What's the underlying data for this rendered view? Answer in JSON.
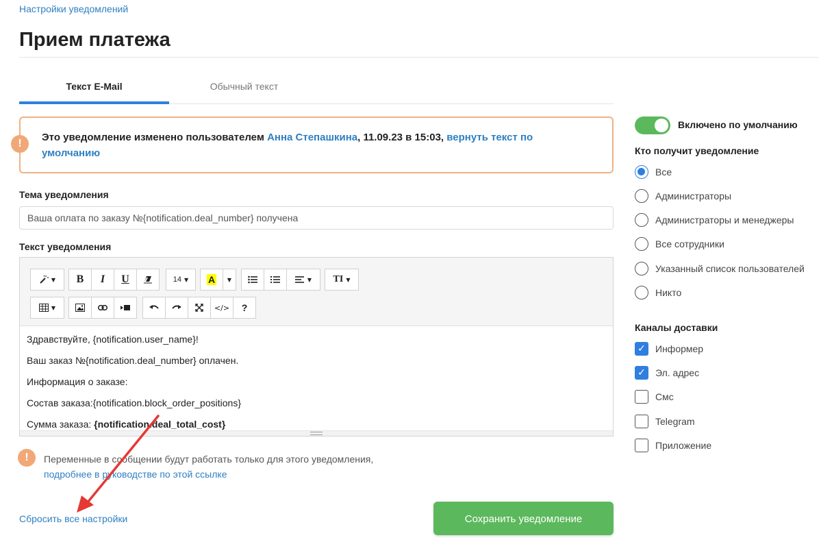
{
  "breadcrumb": "Настройки уведомлений",
  "page_title": "Прием платежа",
  "tabs": [
    {
      "label": "Текст E-Mail",
      "active": true
    },
    {
      "label": "Обычный текст",
      "active": false
    }
  ],
  "alert": {
    "prefix": "Это уведомление изменено пользователем ",
    "user": "Анна Степашкина",
    "middle": ", 11.09.23 в 15:03, ",
    "revert_link": "вернуть текст по умолчанию"
  },
  "subject": {
    "label": "Тема уведомления",
    "value": "Ваша оплата по заказу №{notification.deal_number} получена"
  },
  "body": {
    "label": "Текст уведомления",
    "toolbar": {
      "magic": "magic-wand-icon",
      "bold": "B",
      "italic": "I",
      "underline": "U",
      "eraser": "eraser-icon",
      "font_size": "14",
      "color_letter": "A",
      "text_height": "TI",
      "help": "?",
      "code": "</>"
    },
    "lines": [
      "Здравствуйте, {notification.user_name}!",
      "Ваш заказ №{notification.deal_number} оплачен.",
      "Информация о заказе:",
      "Состав заказа:{notification.block_order_positions}"
    ],
    "last_line_prefix": "Сумма заказа: ",
    "last_line_bold": "{notification.deal_total_cost}"
  },
  "note": {
    "text": "Переменные в сообщении будут работать только для этого уведомления,",
    "link": "подробнее в руководстве по этой ссылке"
  },
  "reset_label": "Сбросить все настройки",
  "save_label": "Сохранить уведомление",
  "enabled_label": "Включено по умолчанию",
  "enabled": true,
  "recipients": {
    "heading": "Кто получит уведомление",
    "options": [
      {
        "label": "Все",
        "selected": true
      },
      {
        "label": "Администраторы",
        "selected": false
      },
      {
        "label": "Администраторы и менеджеры",
        "selected": false
      },
      {
        "label": "Все сотрудники",
        "selected": false
      },
      {
        "label": "Указанный список пользователей",
        "selected": false
      },
      {
        "label": "Никто",
        "selected": false
      }
    ]
  },
  "channels": {
    "heading": "Каналы доставки",
    "options": [
      {
        "label": "Информер",
        "checked": true
      },
      {
        "label": "Эл. адрес",
        "checked": true
      },
      {
        "label": "Смс",
        "checked": false
      },
      {
        "label": "Telegram",
        "checked": false
      },
      {
        "label": "Приложение",
        "checked": false
      }
    ]
  },
  "colors": {
    "accent": "#2f7fe0",
    "link": "#2f7fc1",
    "success": "#5cb85c",
    "warning": "#f1a878",
    "arrow": "#e53935"
  }
}
